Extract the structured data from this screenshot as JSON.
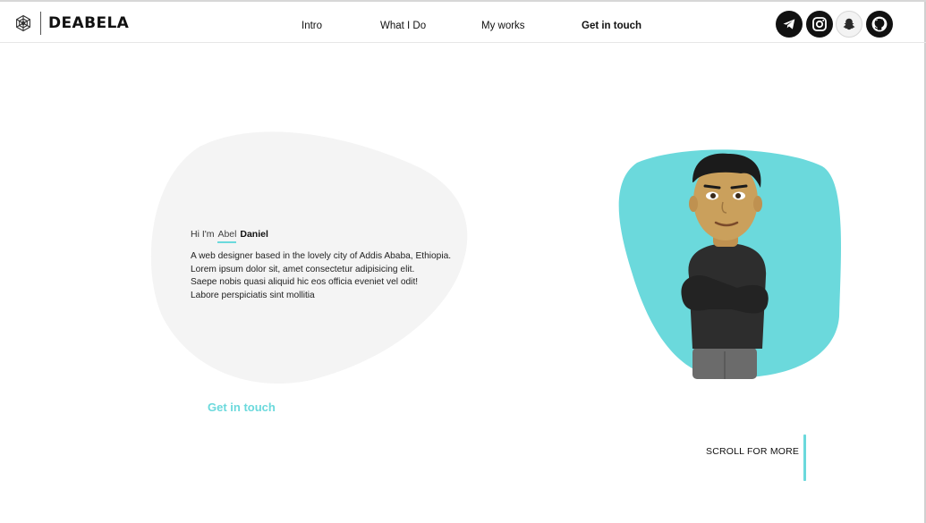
{
  "brand": {
    "name": "DEABELA",
    "logo_icon": "spiderweb-icon"
  },
  "nav": {
    "items": [
      {
        "label": "Intro"
      },
      {
        "label": "What I Do"
      },
      {
        "label": "My works"
      },
      {
        "label": "Get in touch",
        "active": true
      }
    ]
  },
  "social": [
    {
      "icon": "telegram-icon"
    },
    {
      "icon": "instagram-icon"
    },
    {
      "icon": "snapchat-icon"
    },
    {
      "icon": "github-icon"
    }
  ],
  "hero": {
    "greeting_prefix": "Hi I'm",
    "first_name": "Abel",
    "last_name": "Daniel",
    "bio_lines": [
      "A web designer based in the lovely city of Addis Ababa, Ethiopia.",
      "Lorem ipsum dolor sit, amet consectetur adipisicing elit.",
      "Saepe nobis quasi aliquid hic eos officia eveniet vel odit!",
      "Labore perspiciatis sint mollitia"
    ],
    "cta_label": "Get in touch",
    "avatar_icon": "bitmoji-avatar"
  },
  "scroll_hint": {
    "label": "SCROLL FOR MORE"
  },
  "colors": {
    "accent": "#6bd9dc",
    "blob_bg": "#f4f4f4",
    "text": "#111111"
  }
}
